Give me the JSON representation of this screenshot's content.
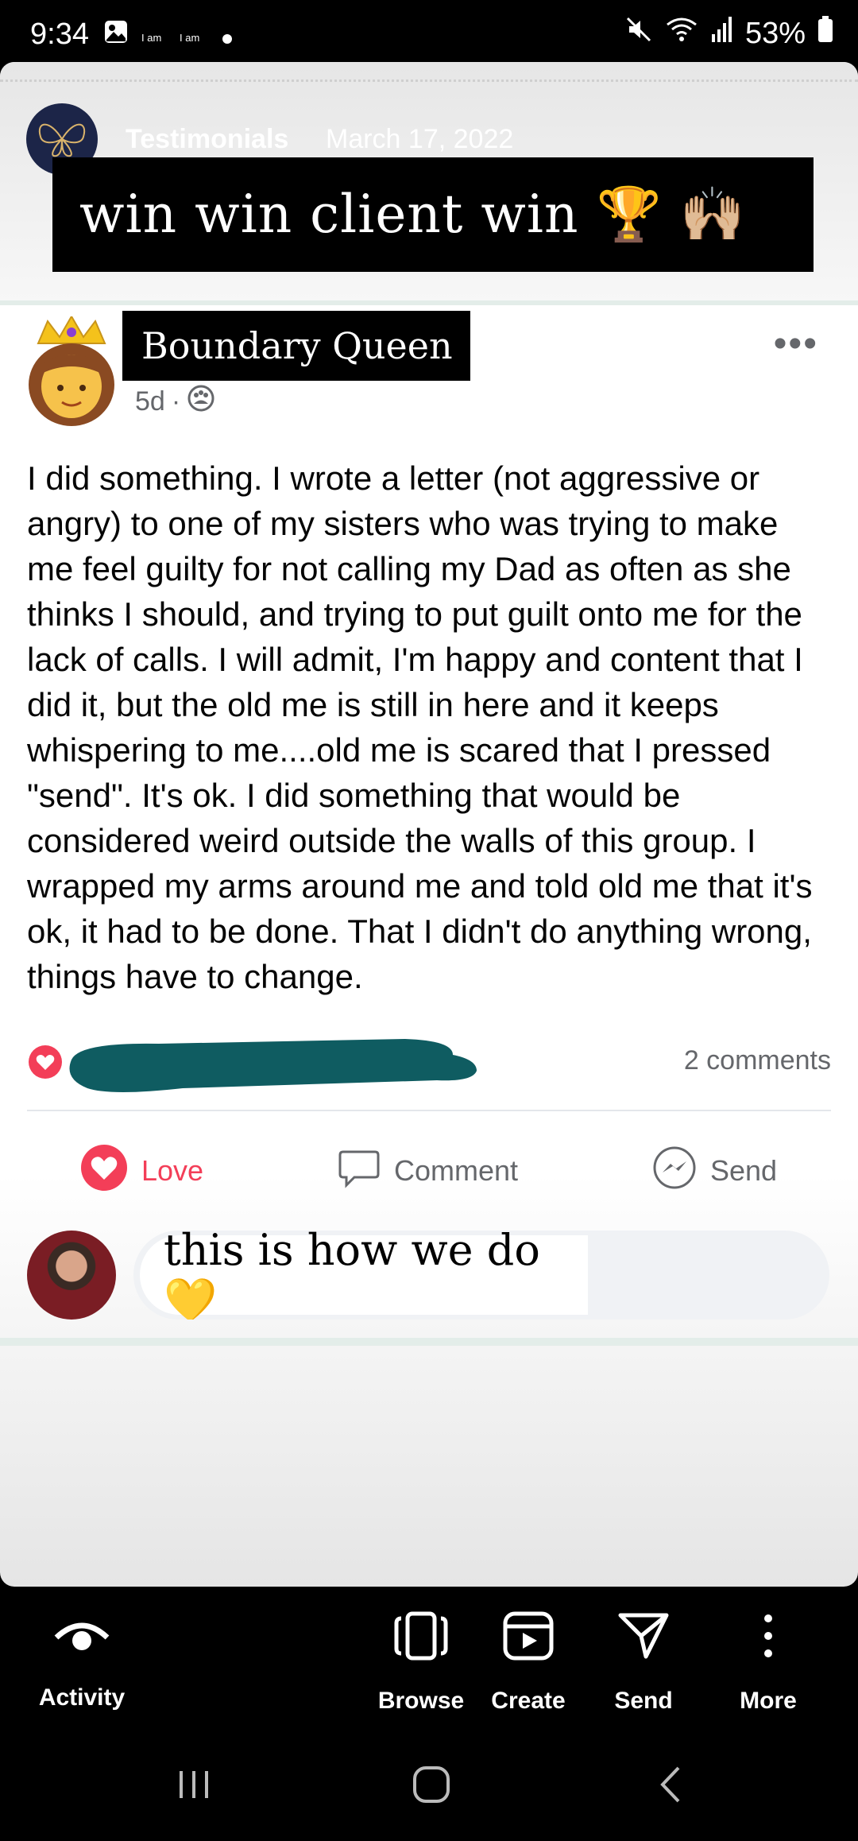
{
  "status_bar": {
    "time": "9:34",
    "small_label_1": "I am",
    "small_label_2": "I am",
    "battery": "53%",
    "icons": [
      "gallery-icon",
      "mute-icon",
      "wifi-icon",
      "signal-icon",
      "battery-icon"
    ]
  },
  "story": {
    "name": "Testimonials",
    "date": "March 17, 2022",
    "headline": "win win client win 🏆 🙌🏼"
  },
  "post": {
    "author": "Boundary Queen",
    "author_emoji": "👸",
    "time_ago": "5d",
    "meta_separator": "·",
    "body": "I did something. I wrote a letter (not aggressive or angry) to one of my sisters who was trying to make me feel guilty for not calling my Dad as often as she thinks I should, and trying to put guilt onto me for the lack of calls. I will admit, I'm happy and content that I did it, but the old me is still in here and it keeps whispering to me....old me is scared that I pressed \"send\". It's ok. I did something that would be considered weird outside the walls of this group. I wrapped my arms around me and told old me that it's ok, it had to be done. That I didn't do anything wrong, things have to change.",
    "comments_count": "2 comments"
  },
  "actions": {
    "love": "Love",
    "comment": "Comment",
    "send": "Send"
  },
  "comment": {
    "text": "this is how we do 💛"
  },
  "bottom_nav": {
    "activity": "Activity",
    "browse": "Browse",
    "create": "Create",
    "send": "Send",
    "more": "More"
  },
  "colors": {
    "love_red": "#f33e58",
    "redaction_teal": "#0f5c61",
    "meta_gray": "#65676b"
  }
}
